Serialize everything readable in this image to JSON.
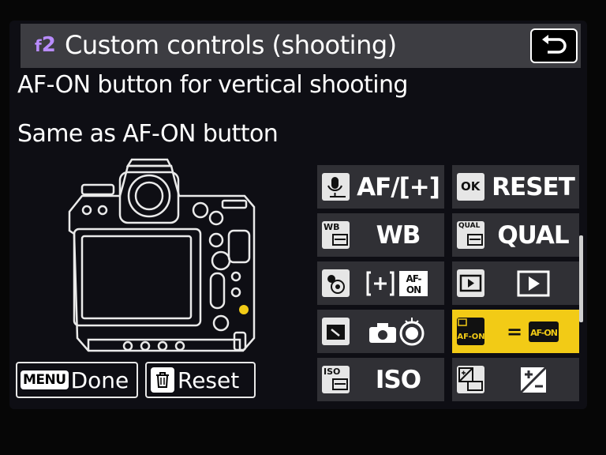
{
  "header": {
    "menu_code": "f2",
    "menu_letter": "f",
    "menu_number": "2",
    "title": "Custom controls (shooting)"
  },
  "setting": {
    "name": "AF-ON button for vertical shooting",
    "value": "Same as AF-ON button"
  },
  "footer": {
    "done_key": "MENU",
    "done_label": "Done",
    "reset_label": "Reset"
  },
  "grid": [
    {
      "icon": "mic-icon",
      "value": "AF/[+]"
    },
    {
      "icon": "ok-button-icon",
      "icon_text": "OK",
      "value": "RESET"
    },
    {
      "icon": "wb-button-icon",
      "icon_text": "WB",
      "value": "WB"
    },
    {
      "icon": "qual-button-icon",
      "icon_text": "QUAL",
      "value": "QUAL"
    },
    {
      "icon": "subselector-center-icon",
      "value": "[+] AF-ON"
    },
    {
      "icon": "playback-icon",
      "value": "playback"
    },
    {
      "icon": "movie-record-icon",
      "value": "shutter-release"
    },
    {
      "icon": "vertical-af-on-icon",
      "icon_text": "AF-ON",
      "value": "= AF-ON"
    },
    {
      "icon": "iso-button-icon",
      "icon_text": "ISO",
      "value": "ISO"
    },
    {
      "icon": "exposure-comp-icon",
      "value": "exposure-comp"
    }
  ],
  "colors": {
    "accent": "#f2cb16",
    "header": "#3d3d42",
    "cell": "#303035",
    "menu_code": "#b98cff"
  }
}
